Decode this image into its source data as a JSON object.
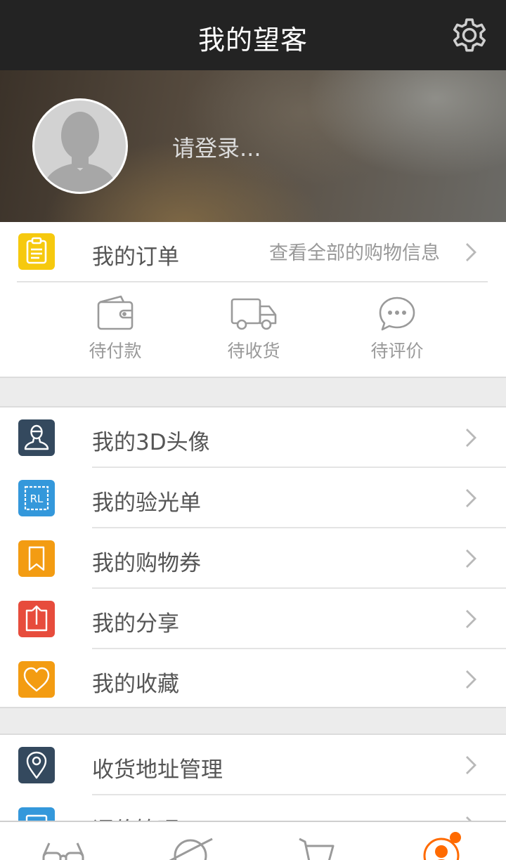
{
  "header": {
    "title": "我的望客",
    "settings_icon": "gear-icon"
  },
  "profile": {
    "login_prompt": "请登录...",
    "avatar_icon": "user-silhouette-icon"
  },
  "orders": {
    "label": "我的订单",
    "hint": "查看全部的购物信息",
    "icon": "clipboard-icon",
    "icon_color": "#f6c90e",
    "statuses": [
      {
        "label": "待付款",
        "icon": "wallet-icon"
      },
      {
        "label": "待收货",
        "icon": "truck-icon"
      },
      {
        "label": "待评价",
        "icon": "comment-icon"
      }
    ]
  },
  "menu_group_1": [
    {
      "label": "我的3D头像",
      "icon": "avatar-3d-icon",
      "color": "#34495e"
    },
    {
      "label": "我的验光单",
      "icon": "prescription-rl-icon",
      "color": "#3498db"
    },
    {
      "label": "我的购物券",
      "icon": "bookmark-icon",
      "color": "#f39c12"
    },
    {
      "label": "我的分享",
      "icon": "share-icon",
      "color": "#e74c3c"
    },
    {
      "label": "我的收藏",
      "icon": "heart-icon",
      "color": "#f39c12"
    }
  ],
  "menu_group_2": [
    {
      "label": "收货地址管理",
      "icon": "location-pin-icon",
      "color": "#34495e"
    },
    {
      "label": "评价管理",
      "icon": "review-icon",
      "color": "#3498db"
    }
  ],
  "tabbar": {
    "active_color": "#ff6a00",
    "items": [
      {
        "name": "glasses",
        "icon": "glasses-icon"
      },
      {
        "name": "discover",
        "icon": "planet-icon"
      },
      {
        "name": "cart",
        "icon": "cart-icon"
      },
      {
        "name": "me",
        "icon": "profile-icon",
        "active": true
      }
    ]
  }
}
